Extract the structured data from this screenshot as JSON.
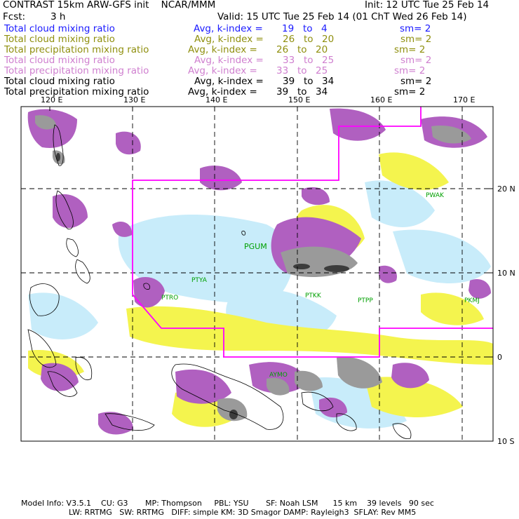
{
  "header": {
    "title_left": "CONTRAST 15km ARW-GFS init    NCAR/MMM",
    "init": "Init: 12 UTC Tue 25 Feb 14",
    "fcst_label": "Fcst:",
    "fcst_value": "3 h",
    "valid": "Valid: 15 UTC Tue 25 Feb 14 (01 ChT Wed 26 Feb 14)"
  },
  "fields": [
    {
      "name": "Total cloud mixing ratio",
      "avg": "Avg, k-index =",
      "k1": "19",
      "to": "to",
      "k2": "4",
      "sm": "sm= 2",
      "color": "#1a1aff"
    },
    {
      "name": "Total cloud mixing ratio",
      "avg": "Avg, k-index =",
      "k1": "26",
      "to": "to",
      "k2": "20",
      "sm": "sm= 2",
      "color": "#8f8f0e"
    },
    {
      "name": "Total precipitation mixing ratio",
      "avg": "Avg, k-index =",
      "k1": "26",
      "to": "to",
      "k2": "20",
      "sm": "sm= 2",
      "color": "#8f8f0e"
    },
    {
      "name": "Total cloud mixing ratio",
      "avg": "Avg, k-index =",
      "k1": "33",
      "to": "to",
      "k2": "25",
      "sm": "sm= 2",
      "color": "#cf7fcf"
    },
    {
      "name": "Total precipitation mixing ratio",
      "avg": "Avg, k-index =",
      "k1": "33",
      "to": "to",
      "k2": "25",
      "sm": "sm= 2",
      "color": "#cf7fcf"
    },
    {
      "name": "Total cloud mixing ratio",
      "avg": "Avg, k-index =",
      "k1": "39",
      "to": "to",
      "k2": "34",
      "sm": "sm= 2",
      "color": "#000000"
    },
    {
      "name": "Total precipitation mixing ratio",
      "avg": "Avg, k-index =",
      "k1": "39",
      "to": "to",
      "k2": "34",
      "sm": "sm= 2",
      "color": "#000000"
    }
  ],
  "map": {
    "lon_labels": [
      "120 E",
      "130 E",
      "140 E",
      "150 E",
      "160 E",
      "170 E"
    ],
    "lat_labels": [
      "20 N",
      "10 N",
      "0",
      "10 S"
    ],
    "stations": [
      "PWAK",
      "PGUM",
      "PTYA",
      "PTRO",
      "PTKK",
      "PTPP",
      "PKMJ",
      "AYMO"
    ],
    "colors": {
      "light_cloud": "#c8ecfa",
      "yellow": "#f4f44e",
      "purple": "#b060c0",
      "gray": "#9a9a9a",
      "boundary": "#ff00ff",
      "station_text": "#00a000"
    }
  },
  "footer": {
    "line1": "Model Info: V3.5.1    CU: G3       MP: Thompson     PBL: YSU       SF: Noah LSM      15 km    39 levels   90 sec",
    "line2": "LW: RRTMG   SW: RRTMG   DIFF: simple KM: 3D Smagor DAMP: Rayleigh3  SFLAY: Rev MM5"
  }
}
